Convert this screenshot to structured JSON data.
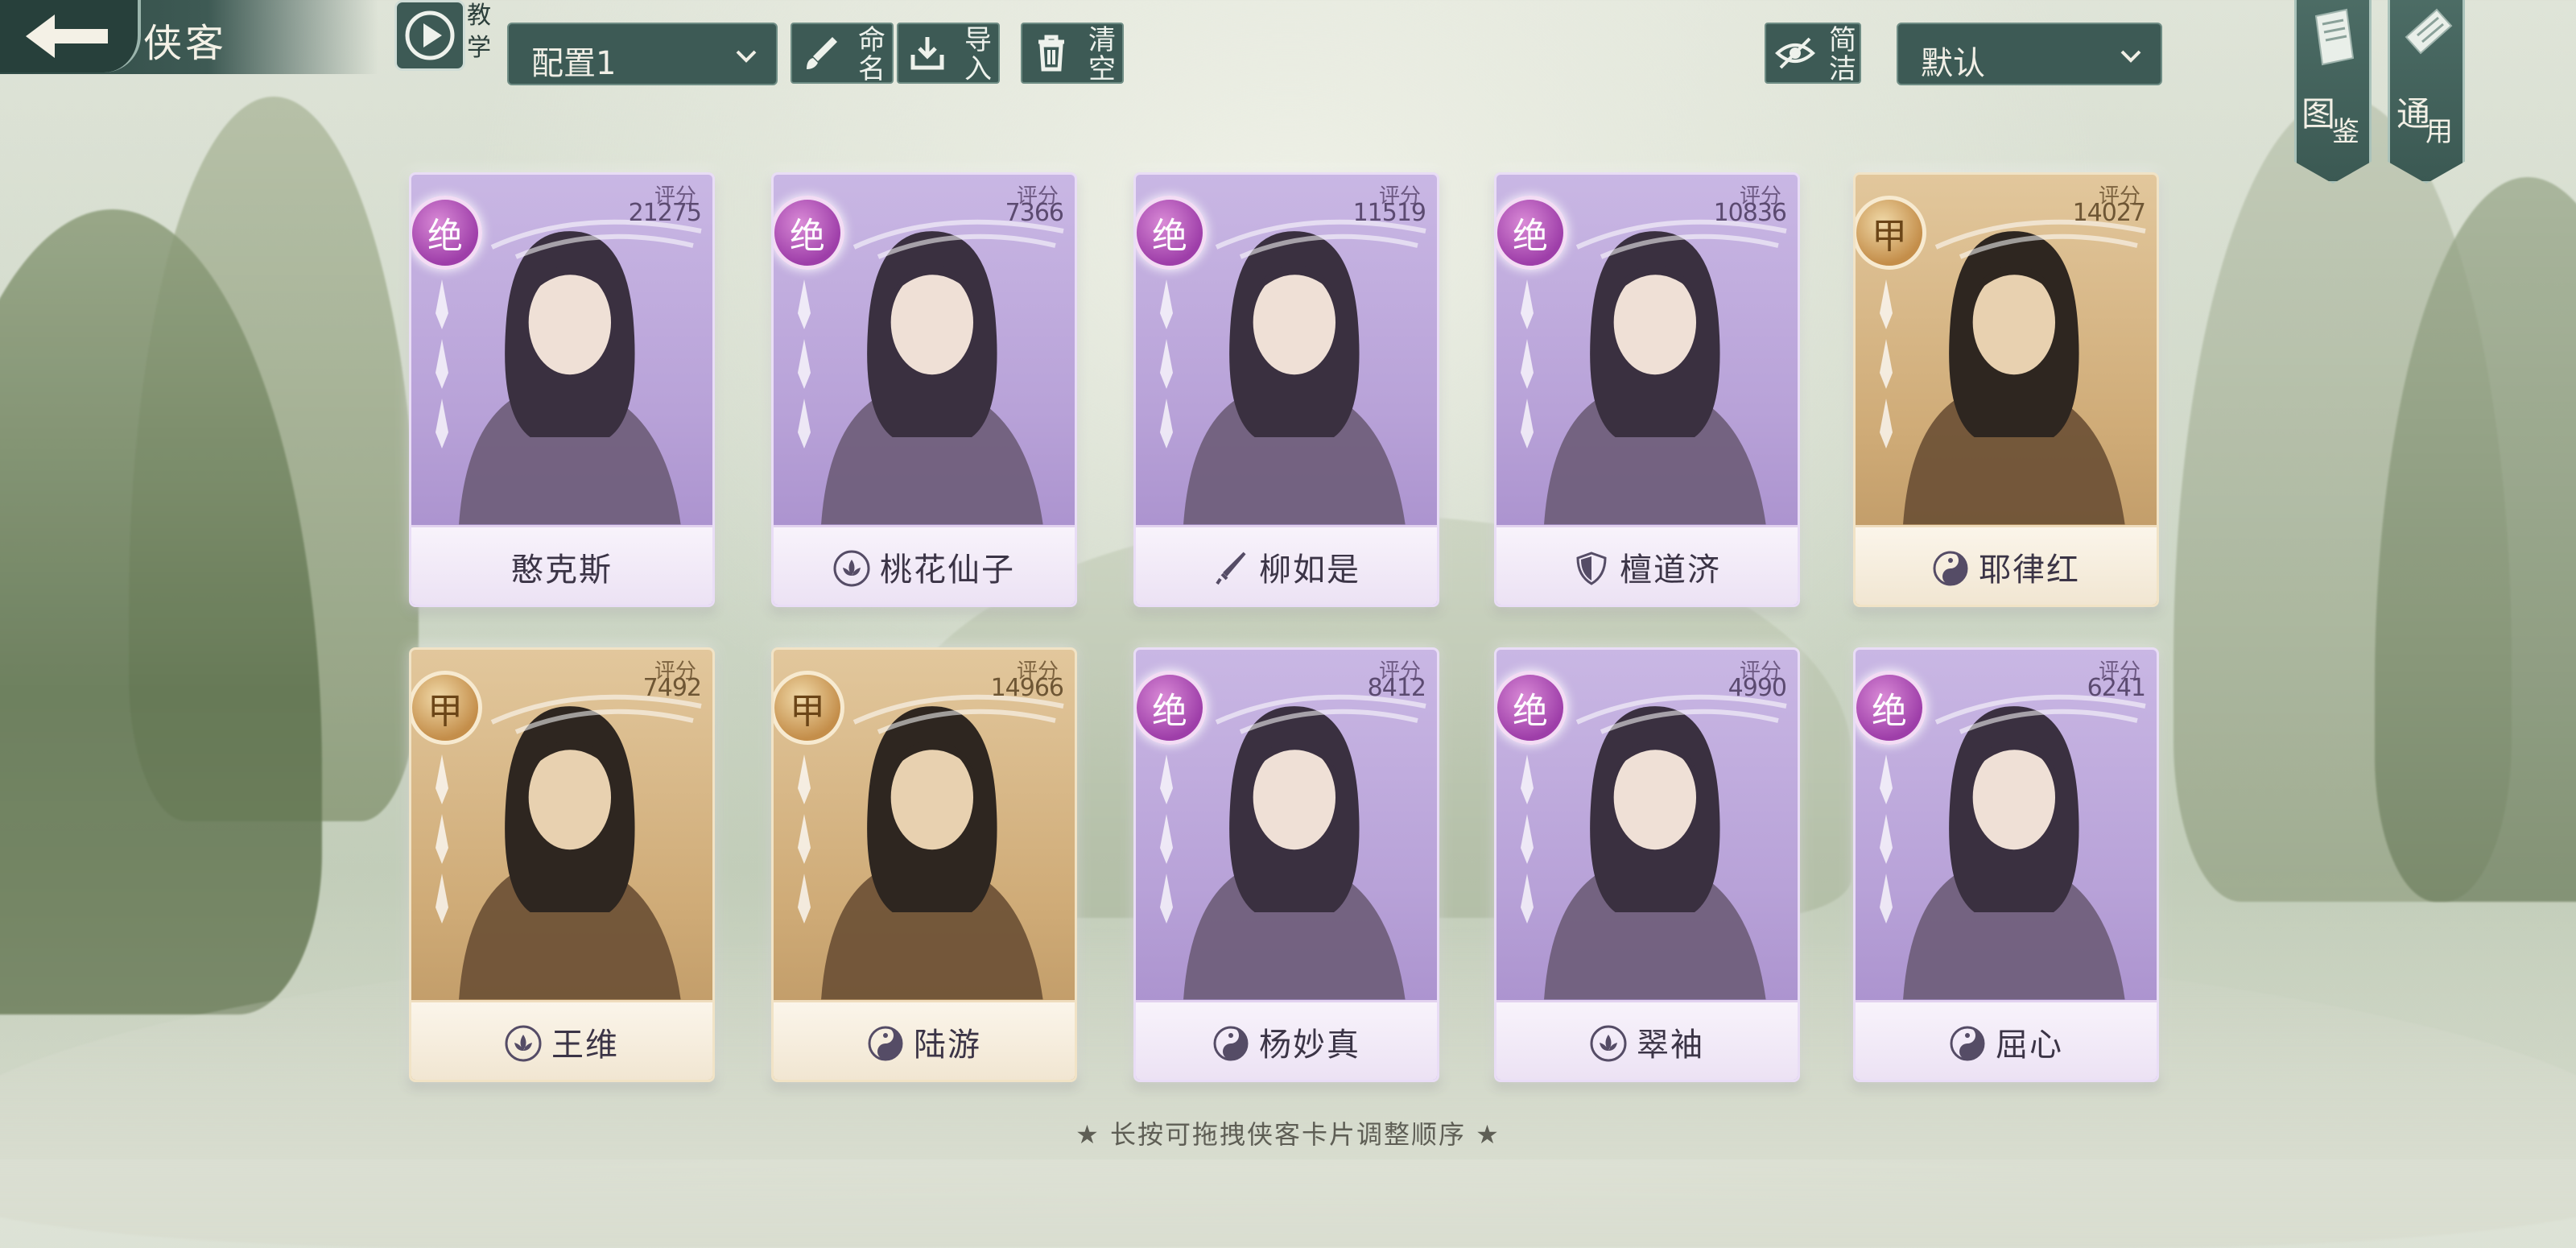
{
  "header": {
    "title": "侠客",
    "tutorial_label": "教学",
    "config_select": "配置1",
    "rename_label": "命名",
    "import_label": "导入",
    "clear_label": "清空",
    "simple_label": "简洁",
    "sort_select": "默认",
    "codex_label_1": "图",
    "codex_label_2": "鉴",
    "common_label_1": "通",
    "common_label_2": "用"
  },
  "score_label": "评分",
  "cards": [
    {
      "rank": "绝",
      "score": "21275",
      "name": "憨克斯",
      "sect": "",
      "tier": "purple"
    },
    {
      "rank": "绝",
      "score": "7366",
      "name": "桃花仙子",
      "sect": "lotus-icon",
      "tier": "purple"
    },
    {
      "rank": "绝",
      "score": "11519",
      "name": "柳如是",
      "sect": "sword-icon",
      "tier": "purple"
    },
    {
      "rank": "绝",
      "score": "10836",
      "name": "檀道济",
      "sect": "shield-icon",
      "tier": "purple"
    },
    {
      "rank": "甲",
      "score": "14027",
      "name": "耶律红",
      "sect": "taiji-icon",
      "tier": "gold"
    },
    {
      "rank": "甲",
      "score": "7492",
      "name": "王维",
      "sect": "lotus-icon",
      "tier": "gold"
    },
    {
      "rank": "甲",
      "score": "14966",
      "name": "陆游",
      "sect": "taiji-icon",
      "tier": "gold"
    },
    {
      "rank": "绝",
      "score": "8412",
      "name": "杨妙真",
      "sect": "taiji-icon",
      "tier": "purple"
    },
    {
      "rank": "绝",
      "score": "4990",
      "name": "翠袖",
      "sect": "lotus-icon",
      "tier": "purple"
    },
    {
      "rank": "绝",
      "score": "6241",
      "name": "屈心",
      "sect": "taiji-icon",
      "tier": "purple"
    }
  ],
  "footer_hint": "★ 长按可拖拽侠客卡片调整顺序 ★"
}
